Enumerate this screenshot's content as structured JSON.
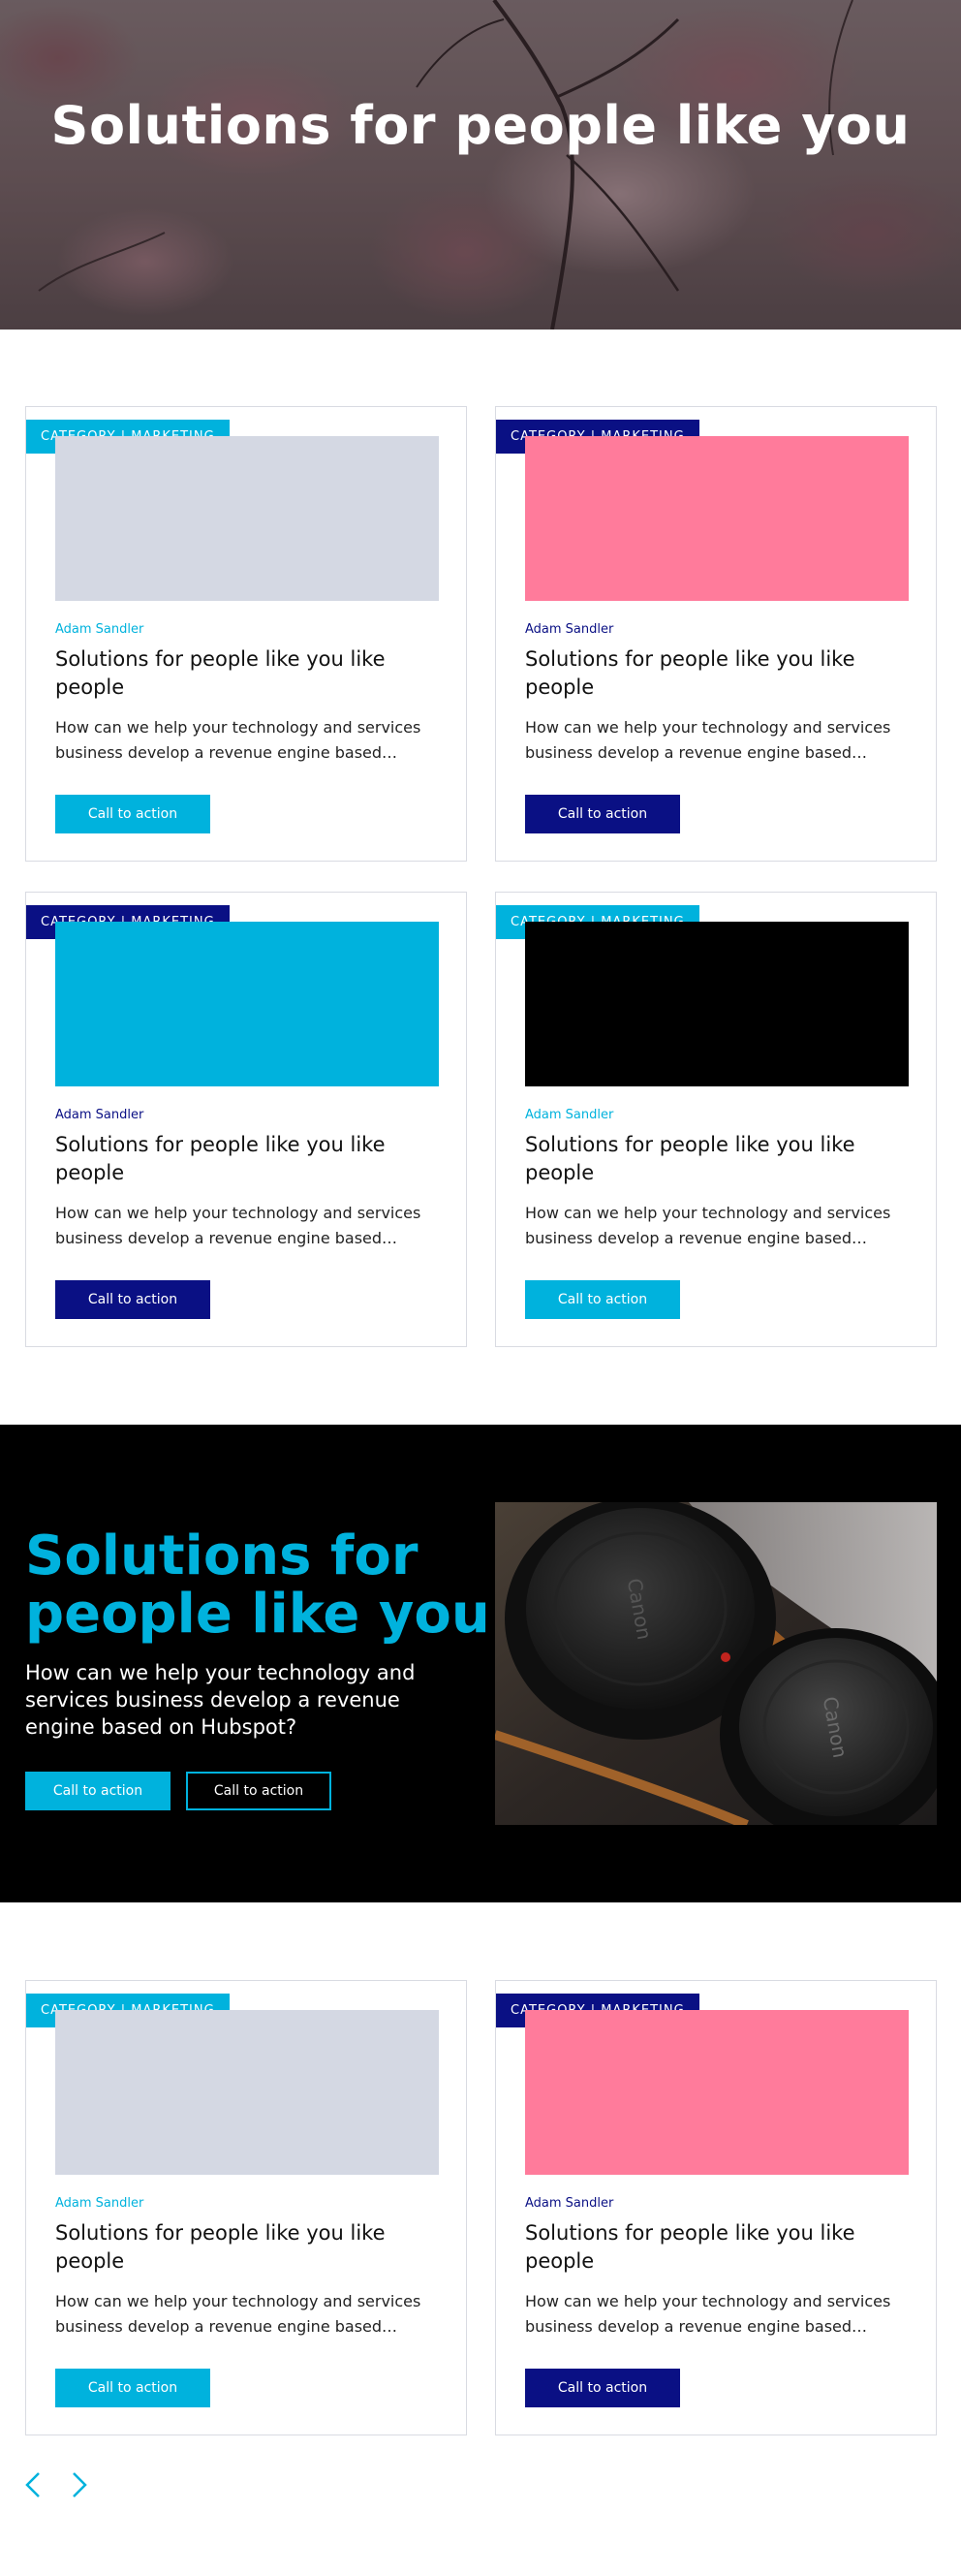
{
  "hero": {
    "title": "Solutions for people like you"
  },
  "colors": {
    "cyan": "#00b2dd",
    "navy": "#0a1084",
    "grey": "#d4d8e3",
    "pink": "#ff7b9b",
    "black": "#000000"
  },
  "cards": [
    {
      "badge": "CATEGORY | MARKETING",
      "badge_color": "cyan",
      "image_color": "grey",
      "author": "Adam Sandler",
      "author_color": "cyan",
      "title": "Solutions for people like you like people",
      "description": "How can we help your technology and services business develop a revenue engine based…",
      "cta": "Call to action",
      "cta_color": "cyan"
    },
    {
      "badge": "CATEGORY | MARKETING",
      "badge_color": "navy",
      "image_color": "pink",
      "author": "Adam Sandler",
      "author_color": "navy",
      "title": "Solutions for people like you like people",
      "description": "How can we help your technology and services business develop a revenue engine based…",
      "cta": "Call to action",
      "cta_color": "navy"
    },
    {
      "badge": "CATEGORY | MARKETING",
      "badge_color": "navy",
      "image_color": "cyan",
      "author": "Adam Sandler",
      "author_color": "navy",
      "title": "Solutions for people like you like people",
      "description": "How can we help your technology and services business develop a revenue engine based…",
      "cta": "Call to action",
      "cta_color": "navy"
    },
    {
      "badge": "CATEGORY | MARKETING",
      "badge_color": "cyan",
      "image_color": "black",
      "author": "Adam Sandler",
      "author_color": "cyan",
      "title": "Solutions for people like you like people",
      "description": "How can we help your technology and services business develop a revenue engine based…",
      "cta": "Call to action",
      "cta_color": "cyan"
    },
    {
      "badge": "CATEGORY | MARKETING",
      "badge_color": "cyan",
      "image_color": "grey",
      "author": "Adam Sandler",
      "author_color": "cyan",
      "title": "Solutions for people like you like people",
      "description": "How can we help your technology and services business develop a revenue engine based…",
      "cta": "Call to action",
      "cta_color": "cyan"
    },
    {
      "badge": "CATEGORY | MARKETING",
      "badge_color": "navy",
      "image_color": "pink",
      "author": "Adam Sandler",
      "author_color": "navy",
      "title": "Solutions for people like you like people",
      "description": "How can we help your technology and services business develop a revenue engine based…",
      "cta": "Call to action",
      "cta_color": "navy"
    }
  ],
  "banner": {
    "title": "Solutions for people like you",
    "text": "How can we help your technology and services business develop a revenue engine based on Hubspot?",
    "primary_cta": "Call to action",
    "secondary_cta": "Call to action",
    "image": "camera-lens-caps-photo",
    "lens_cap_text": "Canon"
  },
  "pagination": {
    "prev_icon": "chevron-left-icon",
    "next_icon": "chevron-right-icon"
  }
}
